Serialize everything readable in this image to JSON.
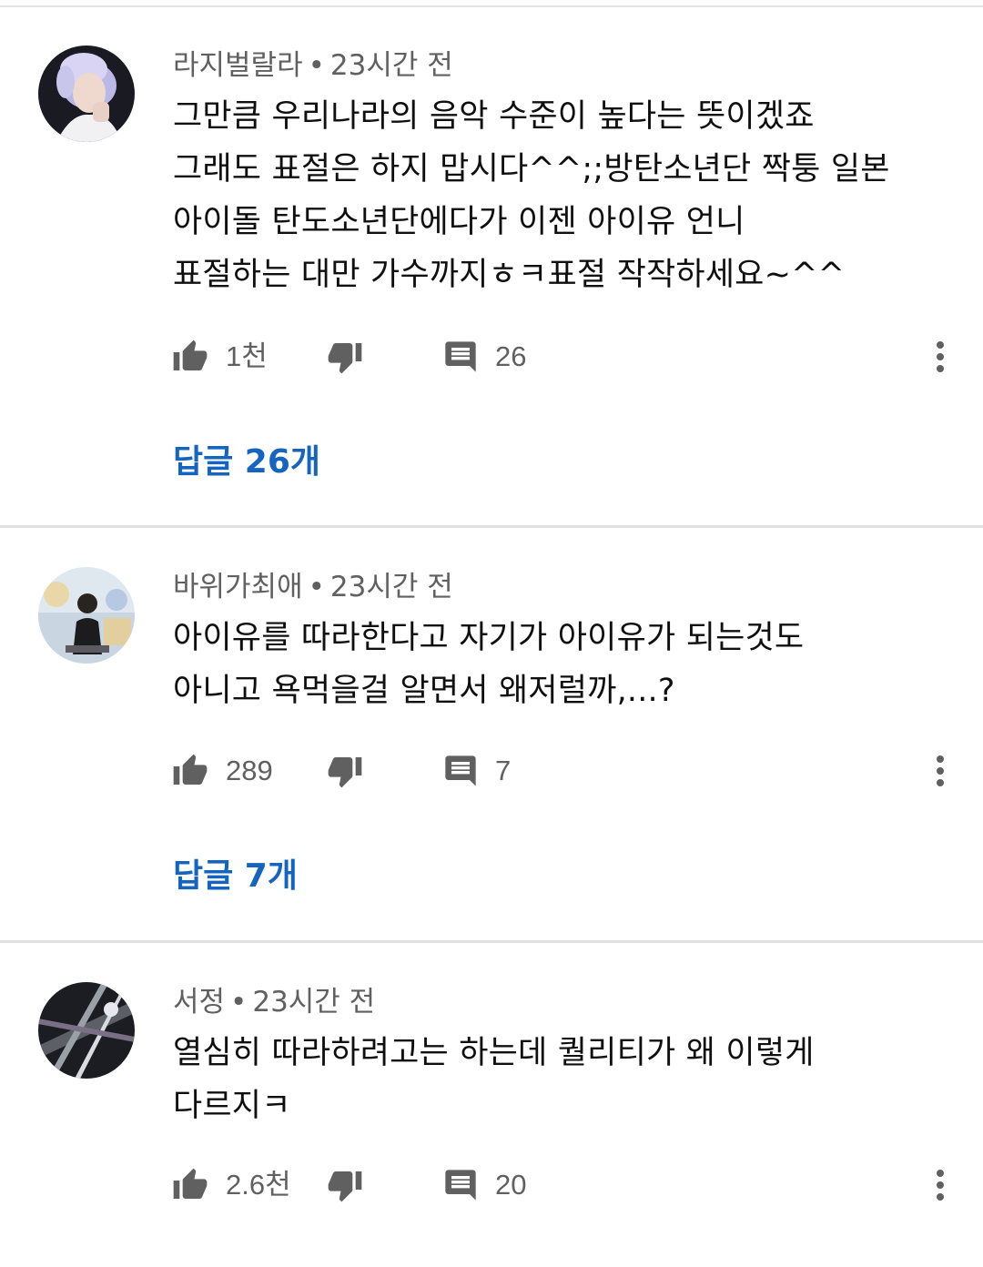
{
  "comments": [
    {
      "author": "라지벌랄라",
      "time": "23시간 전",
      "text": "그만큼 우리나라의 음악 수준이 높다는 뜻이겠죠\n그래도 표절은 하지 맙시다^^;;방탄소년단 짝퉁 일본\n아이돌  탄도소년단에다가 이젠 아이유 언니\n표절하는 대만 가수까지ㅎㅋ표절 작작하세요~^^",
      "likes": "1천",
      "reply_count": "26",
      "replies_label": "답글 26개",
      "avatar_icon": "user-avatar-photo"
    },
    {
      "author": "바위가최애",
      "time": "23시간 전",
      "text": "아이유를 따라한다고 자기가 아이유가 되는것도\n아니고 욕먹을걸 알면서 왜저럴까,...?",
      "likes": "289",
      "reply_count": "7",
      "replies_label": "답글 7개",
      "avatar_icon": "user-avatar-photo"
    },
    {
      "author": "서정",
      "time": "23시간 전",
      "text": "열심히 따라하려고는 하는데 퀄리티가 왜 이렇게\n다르지ㅋ",
      "likes": "2.6천",
      "reply_count": "20",
      "avatar_icon": "user-avatar-photo"
    }
  ],
  "separator": "•",
  "icons": {
    "like": "thumb-up-icon",
    "dislike": "thumb-down-icon",
    "reply": "comment-icon",
    "more": "more-vert-icon"
  },
  "colors": {
    "link": "#1565c0",
    "meta": "#606060",
    "icon": "#606060"
  }
}
